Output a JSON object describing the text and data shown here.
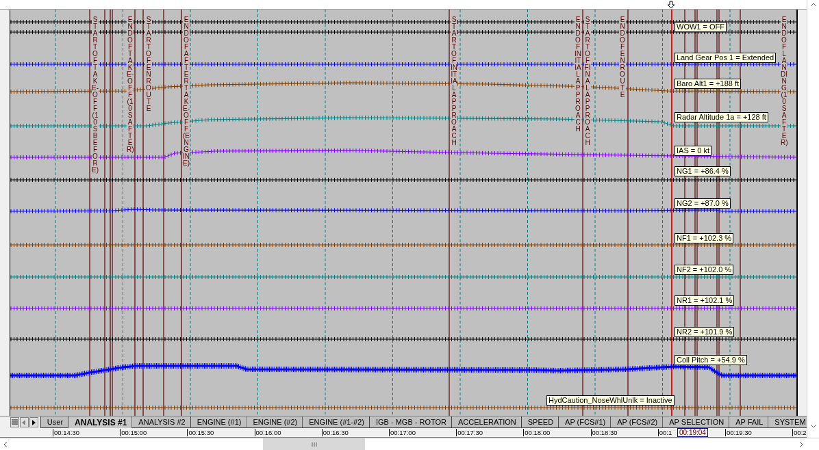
{
  "traces": [
    {
      "kind": "flat",
      "color": "#000000"
    },
    {
      "kind": "flat",
      "color": "#000000",
      "label": "WOW1 = OFF"
    },
    {
      "kind": "flat",
      "color": "#0000ff",
      "label": "Land Gear Pos 1 = Extended"
    },
    {
      "kind": "curve",
      "color": "#804000",
      "label": "Baro Alt1 = +188 ft"
    },
    {
      "kind": "curve",
      "color": "#008080",
      "label": "Radar Altitude 1a = +128 ft"
    },
    {
      "kind": "curve",
      "color": "#8000ff",
      "label": "IAS = 0 kt"
    },
    {
      "kind": "flat",
      "color": "#000000",
      "label": "NG1 = +86.4 %"
    },
    {
      "kind": "curve",
      "color": "#0000ff",
      "label": "NG2 = +87.0 %"
    },
    {
      "kind": "flat",
      "color": "#804000",
      "label": "NF1 = +102.3 %"
    },
    {
      "kind": "flat",
      "color": "#008080",
      "label": "NF2 = +102.0 %"
    },
    {
      "kind": "flat",
      "color": "#8000ff",
      "label": "NR1 = +102.1 %"
    },
    {
      "kind": "flat",
      "color": "#000000",
      "label": "NR2 = +101.9 %"
    },
    {
      "kind": "curve",
      "color": "#0000ff",
      "label": "Coll Pitch = +54.9 %"
    },
    {
      "kind": "flat",
      "color": "#804000",
      "label": "HydCaution_NoseWhlUnlk = Inactive"
    }
  ],
  "events": [
    {
      "label": "START OF TAKE-OFF (10S BEFORE)"
    },
    {
      "label": "END OF TAKE-OFF (10S AFTER)"
    },
    {
      "label": "START OF ENROUTE"
    },
    {
      "label": "END OF AFTER TAKE-OFF (ENGINE)"
    },
    {
      "label": "START OF INITIAL APPROACH"
    },
    {
      "label": "END OF INITIAL APPROACH"
    },
    {
      "label": "START OF FINAL APPROACH"
    },
    {
      "label": "END OF EN ROUTE"
    },
    {
      "label": "END OF LANDING (10S AFTER)"
    }
  ],
  "tabs": [
    {
      "label": "User",
      "selected": false
    },
    {
      "label": "ANALYSIS #1",
      "selected": true
    },
    {
      "label": "ANALYSIS #2",
      "selected": false
    },
    {
      "label": "ENGINE (#1)",
      "selected": false
    },
    {
      "label": "ENGINE (#2)",
      "selected": false
    },
    {
      "label": "ENGINE (#1-#2)",
      "selected": false
    },
    {
      "label": "IGB - MGB - ROTOR",
      "selected": false
    },
    {
      "label": "ACCELERATION",
      "selected": false
    },
    {
      "label": "SPEED",
      "selected": false
    },
    {
      "label": "AP (FCS#1)",
      "selected": false
    },
    {
      "label": "AP (FCS#2)",
      "selected": false
    },
    {
      "label": "AP SELECTION",
      "selected": false
    },
    {
      "label": "AP FAIL",
      "selected": false
    },
    {
      "label": "SYSTEM",
      "selected": false
    }
  ],
  "time_ruler": {
    "ticks": [
      "00:14:30",
      "00:15:00",
      "00:15:30",
      "00:16:00",
      "00:16:30",
      "00:17:00",
      "00:17:30",
      "00:18:00",
      "00:18:30",
      "00:1",
      "00:19:30",
      "00:2"
    ],
    "cursor_time": "00:19:04"
  }
}
